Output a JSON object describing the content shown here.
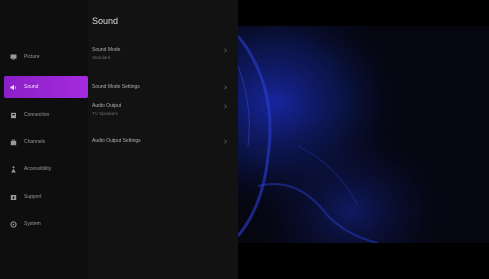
{
  "sidebar": {
    "items": [
      {
        "label": "Picture",
        "icon": "picture-icon"
      },
      {
        "label": "Sound",
        "icon": "speaker-icon"
      },
      {
        "label": "Connection",
        "icon": "connection-icon"
      },
      {
        "label": "Channels",
        "icon": "channels-icon"
      },
      {
        "label": "Accessibility",
        "icon": "accessibility-icon"
      },
      {
        "label": "Support",
        "icon": "support-icon"
      },
      {
        "label": "System",
        "icon": "system-icon"
      }
    ],
    "active_index": 1
  },
  "panel": {
    "title": "Sound",
    "options": [
      {
        "name": "Sound Mode",
        "value": "Standard"
      },
      {
        "name": "Sound Mode Settings",
        "value": ""
      },
      {
        "name": "Audio Output",
        "value": "TV Speakers"
      },
      {
        "name": "Audio Output Settings",
        "value": ""
      }
    ]
  },
  "colors": {
    "accent": "#9b27d8",
    "panel": "#121212",
    "rail": "#0e0e0e",
    "art_glow": "#1b2bb8"
  }
}
